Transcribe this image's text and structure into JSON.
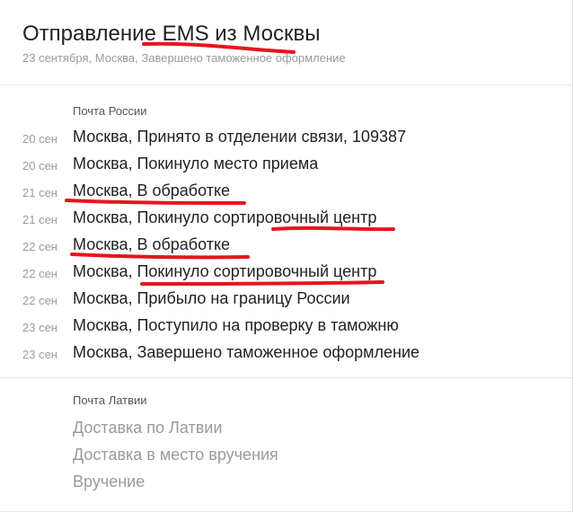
{
  "shipment": {
    "title": "Отправление EMS из Москвы",
    "status_line": "23 сентября, Москва, Завершено таможенное оформление"
  },
  "sections": [
    {
      "label": "Почта России",
      "events": [
        {
          "date": "20 сен",
          "text": "Москва, Принято в отделении связи, 109387"
        },
        {
          "date": "20 сен",
          "text": "Москва, Покинуло место приема"
        },
        {
          "date": "21 сен",
          "text": "Москва, В обработке"
        },
        {
          "date": "21 сен",
          "text": "Москва, Покинуло сортировочный центр"
        },
        {
          "date": "22 сен",
          "text": "Москва, В обработке"
        },
        {
          "date": "22 сен",
          "text": "Москва, Покинуло сортировочный центр"
        },
        {
          "date": "22 сен",
          "text": "Москва, Прибыло на границу России"
        },
        {
          "date": "23 сен",
          "text": "Москва, Поступило на проверку в таможню"
        },
        {
          "date": "23 сен",
          "text": "Москва, Завершено таможенное оформление"
        }
      ]
    },
    {
      "label": "Почта Латвии",
      "pending": [
        "Доставка по Латвии",
        "Доставка в место вручения",
        "Вручение"
      ]
    }
  ],
  "annotation_color": "#e8141c"
}
